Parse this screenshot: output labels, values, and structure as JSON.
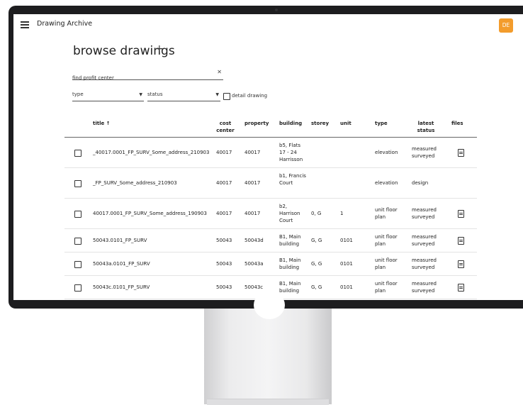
{
  "app": {
    "title": "Drawing Archive",
    "user_initials": "DE",
    "accent": "#f39c2c"
  },
  "page": {
    "title": "browse drawings",
    "add_icon": "plus-icon"
  },
  "search": {
    "placeholder": "find profit center",
    "clear_icon": "close-icon"
  },
  "filters": {
    "type_label": "type",
    "status_label": "status",
    "detail_label": "detail drawing"
  },
  "table": {
    "headers": {
      "title": "title ↑",
      "cost_center": "cost center",
      "property": "property",
      "building": "building",
      "storey": "storey",
      "unit": "unit",
      "type": "type",
      "latest_status": "latest status",
      "files": "files"
    },
    "rows": [
      {
        "title": "_40017.0001_FP_SURV_Some_address_210903",
        "cost_center": "40017",
        "property": "40017",
        "building": "b5, Flats 17 - 24 Harrisson",
        "storey": "",
        "unit": "",
        "type": "elevation",
        "status": "measured surveyed"
      },
      {
        "title": "_FP_SURV_Some_address_210903",
        "cost_center": "40017",
        "property": "40017",
        "building": "b1, Francis Court",
        "storey": "",
        "unit": "",
        "type": "elevation",
        "status": "design"
      },
      {
        "title": "40017.0001_FP_SURV_Some_address_190903",
        "cost_center": "40017",
        "property": "40017",
        "building": "b2, Harrison Court",
        "storey": "0, G",
        "unit": "1",
        "type": "unit floor plan",
        "status": "measured surveyed"
      },
      {
        "title": "50043.0101_FP_SURV",
        "cost_center": "50043",
        "property": "50043d",
        "building": "B1, Main building",
        "storey": "G, G",
        "unit": "0101",
        "type": "unit floor plan",
        "status": "measured surveyed"
      },
      {
        "title": "50043a.0101_FP_SURV",
        "cost_center": "50043",
        "property": "50043a",
        "building": "B1, Main building",
        "storey": "G, G",
        "unit": "0101",
        "type": "unit floor plan",
        "status": "measured surveyed"
      },
      {
        "title": "50043c.0101_FP_SURV",
        "cost_center": "50043",
        "property": "50043c",
        "building": "B1, Main building",
        "storey": "G, G",
        "unit": "0101",
        "type": "unit floor plan",
        "status": "measured surveyed"
      }
    ]
  }
}
